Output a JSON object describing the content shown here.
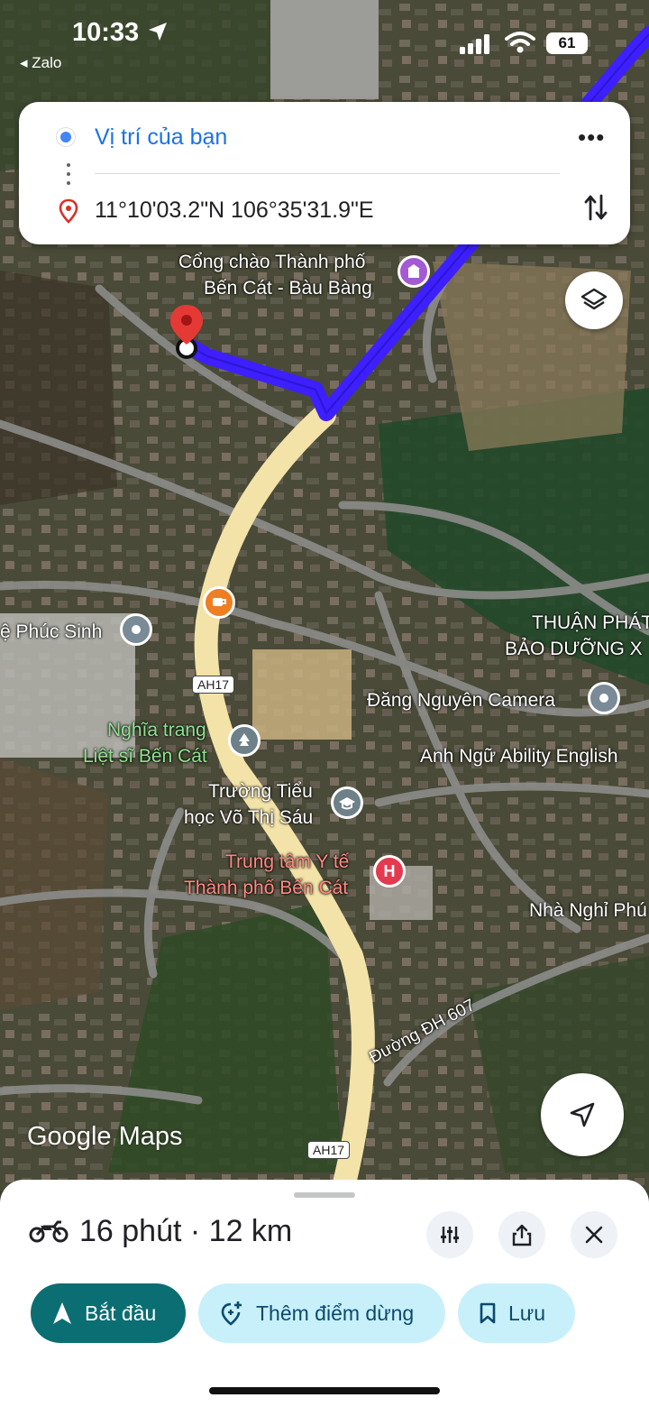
{
  "status_bar": {
    "time": "10:33",
    "back_app": "◂ Zalo",
    "battery": "61"
  },
  "route_card": {
    "origin": "Vị trí của bạn",
    "destination": "11°10'03.2\"N 106°35'31.9\"E",
    "more_label": "•••"
  },
  "map": {
    "labels": {
      "gate": "Cổng chào Thành phố",
      "gate2": "Bến Cát - Bàu Bàng",
      "phuc_sinh": "ệ Phúc Sinh",
      "thuan_phat": "THUẬN PHÁT",
      "bao_duong": "BẢO DƯỠNG X",
      "camera": "Đăng Nguyên Camera",
      "nghia_trang_1": "Nghĩa trang",
      "nghia_trang_2": "Liệt sĩ Bến Cát",
      "anh_ngu": "Anh Ngữ Ability English",
      "truong_1": "Trường Tiểu",
      "truong_2": "học Võ Thị Sáu",
      "trung_tam_1": "Trung tâm Y tế",
      "trung_tam_2": "Thành phố Bến Cát",
      "nha_nghi": "Nhà Nghỉ Phú",
      "duong_dh": "Đường ĐH 607"
    },
    "road_shields": {
      "ah17_top": "AH17",
      "ah17_bottom": "AH17"
    },
    "watermark": "Google Maps"
  },
  "sheet": {
    "summary": "16 phút · 12 km",
    "start_label": "Bắt đầu",
    "add_stop_label": "Thêm điểm dừng",
    "save_label": "Lưu"
  },
  "colors": {
    "route": "#3d1fff",
    "highway": "#f3e3a8",
    "start_button": "#0b6e73",
    "secondary_button": "#c8f0fa",
    "origin_text": "#1a73e8",
    "pin": "#e53935"
  },
  "icons": [
    "location-arrow-icon",
    "signal-icon",
    "wifi-icon",
    "battery-icon",
    "origin-dot-icon",
    "destination-pin-icon",
    "more-icon",
    "swap-icon",
    "layers-icon",
    "recenter-icon",
    "motorbike-icon",
    "filter-icon",
    "share-icon",
    "close-icon",
    "navigation-icon",
    "add-stop-icon",
    "bookmark-icon"
  ]
}
